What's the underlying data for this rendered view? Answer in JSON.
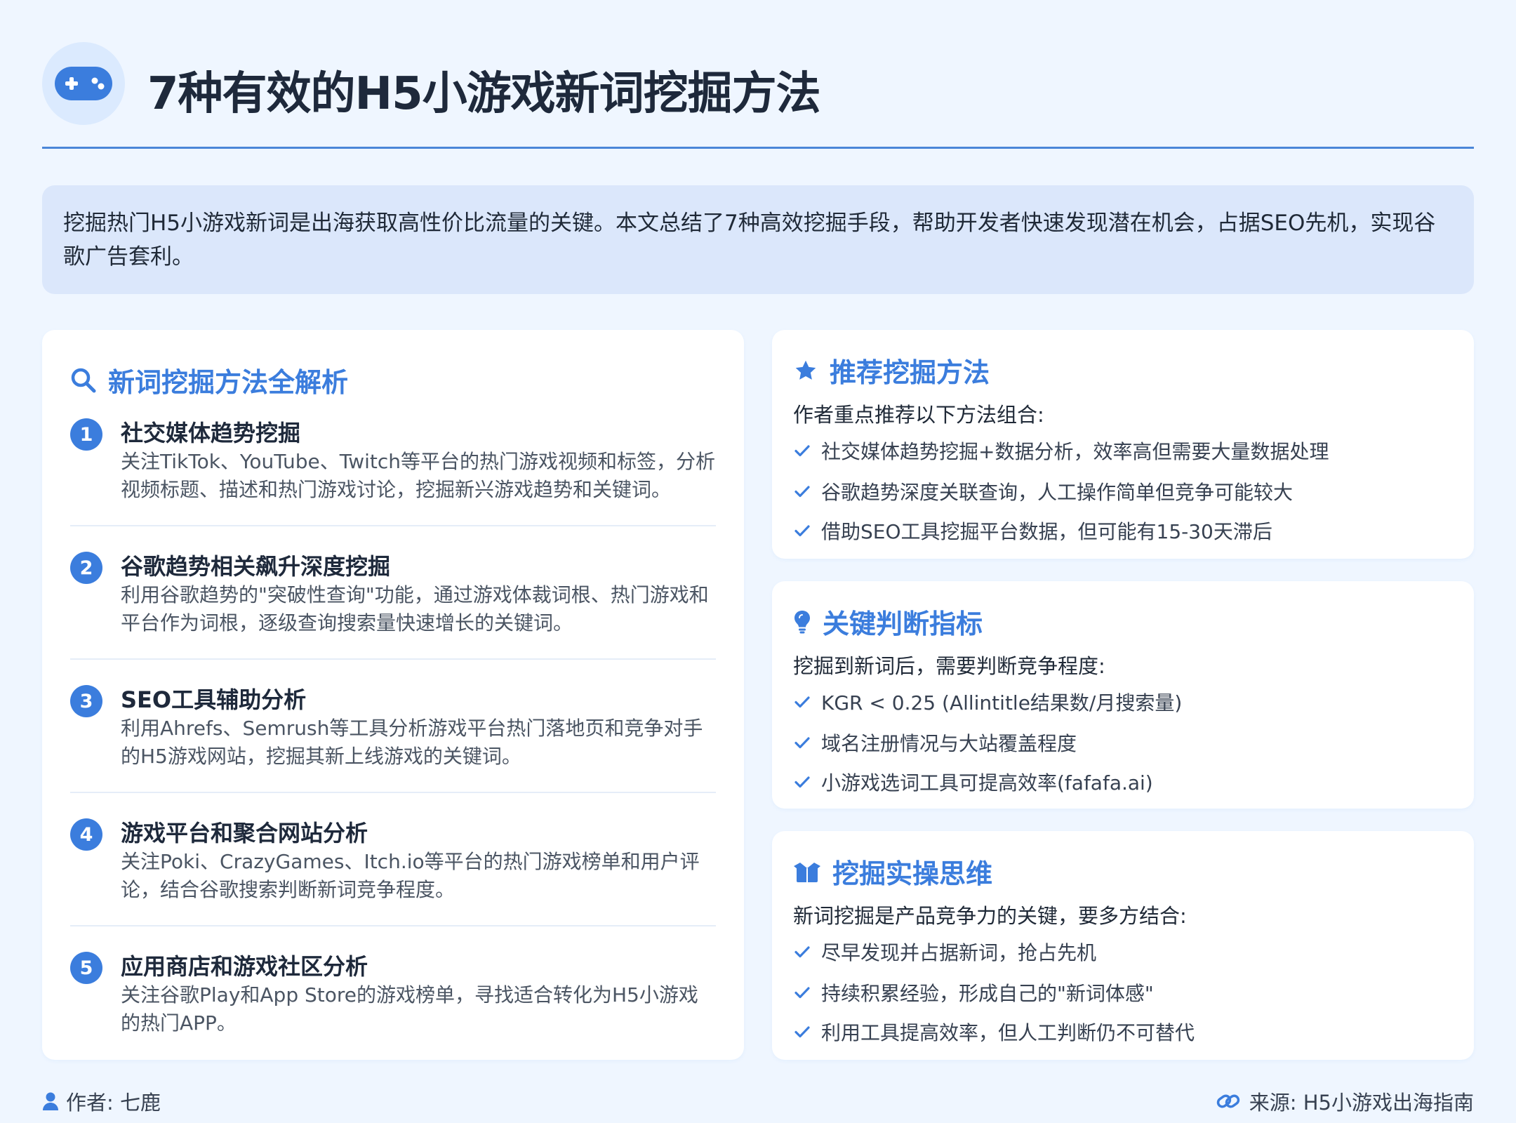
{
  "header": {
    "title": "7种有效的H5小游戏新词挖掘方法",
    "icon": "gamepad-icon"
  },
  "intro": {
    "text": "挖掘热门H5小游戏新词是出海获取高性价比流量的关键。本文总结了7种高效挖掘手段，帮助开发者快速发现潜在机会，占据SEO先机，实现谷歌广告套利。"
  },
  "methods_card": {
    "title": "新词挖掘方法全解析",
    "icon": "search-icon",
    "items": [
      {
        "num": "1",
        "title": "社交媒体趋势挖掘",
        "desc": "关注TikTok、YouTube、Twitch等平台的热门游戏视频和标签，分析视频标题、描述和热门游戏讨论，挖掘新兴游戏趋势和关键词。"
      },
      {
        "num": "2",
        "title": "谷歌趋势相关飙升深度挖掘",
        "desc": "利用谷歌趋势的\"突破性查询\"功能，通过游戏体裁词根、热门游戏和平台作为词根，逐级查询搜索量快速增长的关键词。"
      },
      {
        "num": "3",
        "title": "SEO工具辅助分析",
        "desc": "利用Ahrefs、Semrush等工具分析游戏平台热门落地页和竞争对手的H5游戏网站，挖掘其新上线游戏的关键词。"
      },
      {
        "num": "4",
        "title": "游戏平台和聚合网站分析",
        "desc": "关注Poki、CrazyGames、Itch.io等平台的热门游戏榜单和用户评论，结合谷歌搜索判断新词竞争程度。"
      },
      {
        "num": "5",
        "title": "应用商店和游戏社区分析",
        "desc": "关注谷歌Play和App Store的游戏榜单，寻找适合转化为H5小游戏的热门APP。"
      }
    ]
  },
  "recommend_card": {
    "title": "推荐挖掘方法",
    "icon": "star-icon",
    "lead": "作者重点推荐以下方法组合:",
    "items": [
      "社交媒体趋势挖掘+数据分析，效率高但需要大量数据处理",
      "谷歌趋势深度关联查询，人工操作简单但竞争可能较大",
      "借助SEO工具挖掘平台数据，但可能有15-30天滞后"
    ]
  },
  "metrics_card": {
    "title": "关键判断指标",
    "icon": "lightbulb-icon",
    "lead": "挖掘到新词后，需要判断竞争程度:",
    "items": [
      "KGR < 0.25 (Allintitle结果数/月搜索量)",
      "域名注册情况与大站覆盖程度",
      "小游戏选词工具可提高效率(fafafa.ai)"
    ]
  },
  "mindset_card": {
    "title": "挖掘实操思维",
    "icon": "box-open-icon",
    "lead": "新词挖掘是产品竞争力的关键，要多方结合:",
    "items": [
      "尽早发现并占据新词，抢占先机",
      "持续积累经验，形成自己的\"新词体感\"",
      "利用工具提高效率，但人工判断仍不可替代"
    ]
  },
  "footer": {
    "author": "作者: 七鹿",
    "source": "来源: H5小游戏出海指南"
  },
  "colors": {
    "accent": "#3b7ddd",
    "background": "#eff6ff",
    "intro_bg": "#dbe7fb",
    "card_bg": "#ffffff"
  }
}
